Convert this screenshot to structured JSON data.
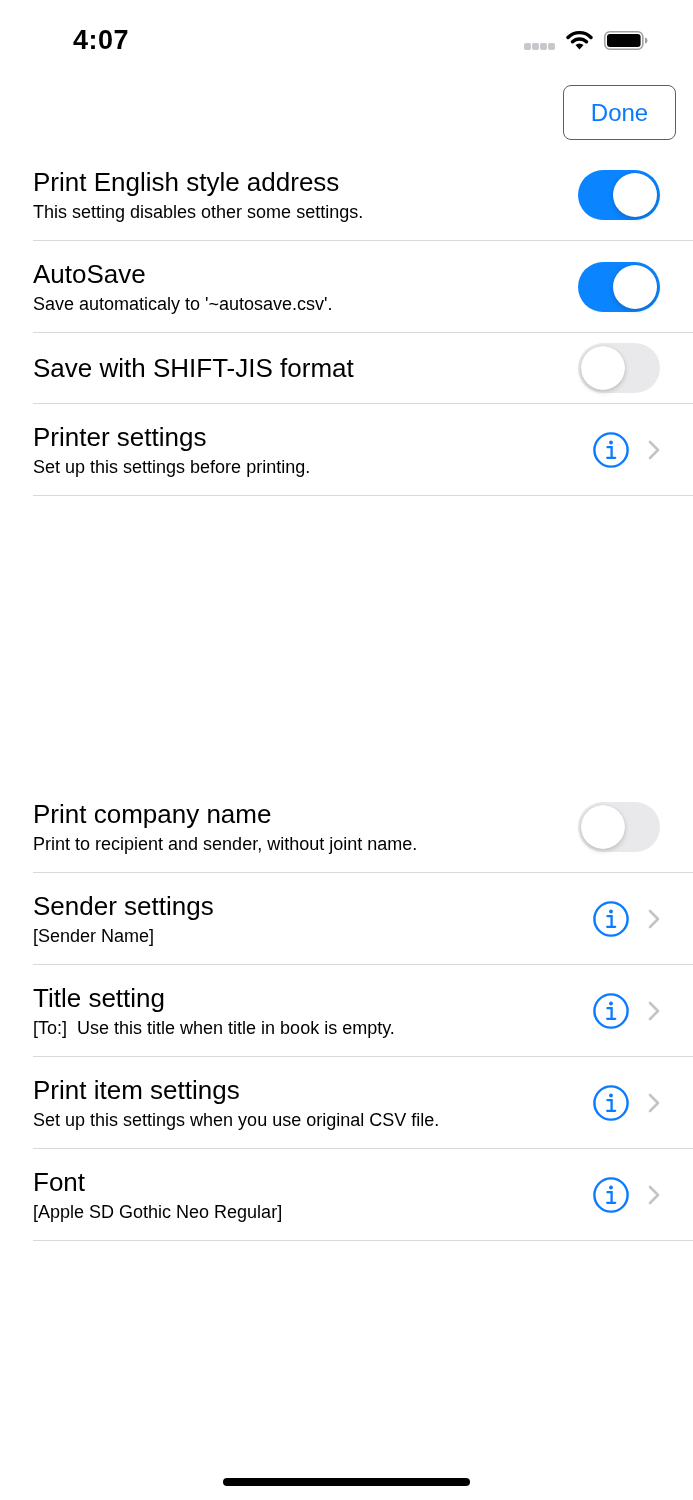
{
  "status_bar": {
    "time": "4:07"
  },
  "done_button": {
    "label": "Done"
  },
  "sections": [
    {
      "rows": [
        {
          "kind": "toggle",
          "title": "Print English style address",
          "subtitle": "This setting disables other some settings.",
          "on": true
        },
        {
          "kind": "toggle",
          "title": "AutoSave",
          "subtitle": "Save automaticaly to '~autosave.csv'.",
          "on": true
        },
        {
          "kind": "toggle",
          "title": "Save with SHIFT-JIS format",
          "on": false
        },
        {
          "kind": "detail",
          "title": "Printer settings",
          "subtitle": "Set up this settings before printing."
        }
      ]
    },
    {
      "rows": [
        {
          "kind": "toggle",
          "title": "Print company name",
          "subtitle": "Print to recipient and sender, without joint name.",
          "on": false
        },
        {
          "kind": "detail",
          "title": "Sender settings",
          "subtitle": "[Sender Name]"
        },
        {
          "kind": "detail",
          "title": "Title setting",
          "subtitle": "[To:]  Use this title when title in book is empty."
        },
        {
          "kind": "detail",
          "title": "Print item settings",
          "subtitle": "Set up this settings when you use original CSV file."
        },
        {
          "kind": "detail",
          "title": "Font",
          "subtitle": "[Apple SD Gothic Neo Regular]"
        }
      ]
    }
  ]
}
